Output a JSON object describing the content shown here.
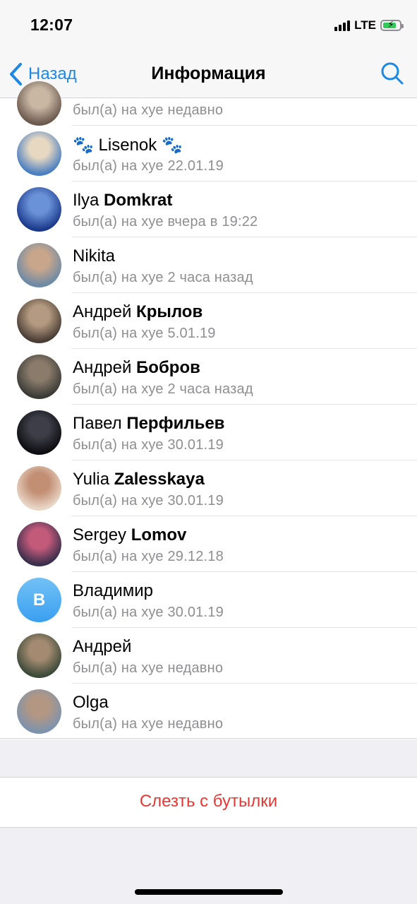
{
  "status_bar": {
    "time": "12:07",
    "network": "LTE"
  },
  "nav": {
    "back_label": "Назад",
    "title": "Информация"
  },
  "members": [
    {
      "name": "",
      "last": "",
      "status": "был(а) на хуе недавно",
      "partial": true,
      "avatar": [
        "#6b5a4e",
        "#c9b7a4"
      ]
    },
    {
      "name": "🐾 Lisenok 🐾",
      "last": "",
      "status": "был(а) на хуе 22.01.19",
      "avatar": [
        "#4a7fc1",
        "#e7d8c2"
      ]
    },
    {
      "name": "Ilya",
      "last": "Domkrat",
      "status": "был(а) на хуе вчера в 19:22",
      "avatar": [
        "#1c3a8c",
        "#6a92d8"
      ]
    },
    {
      "name": "Nikita",
      "last": "",
      "status": "был(а) на хуе 2 часа назад",
      "avatar": [
        "#6e8aa5",
        "#c7a68c"
      ]
    },
    {
      "name": "Андрей",
      "last": "Крылов",
      "status": "был(а) на хуе 5.01.19",
      "avatar": [
        "#4a3e36",
        "#b49a80"
      ]
    },
    {
      "name": "Андрей",
      "last": "Бобров",
      "status": "был(а) на хуе 2 часа назад",
      "avatar": [
        "#3b3b36",
        "#8a7b6b"
      ]
    },
    {
      "name": "Павел",
      "last": "Перфильев",
      "status": "был(а) на хуе 30.01.19",
      "avatar": [
        "#0d0d12",
        "#3e3e48"
      ]
    },
    {
      "name": "Yulia",
      "last": "Zalesskaya",
      "status": "был(а) на хуе 30.01.19",
      "avatar": [
        "#e9d6c6",
        "#c28e74"
      ]
    },
    {
      "name": "Sergey",
      "last": "Lomov",
      "status": "был(а) на хуе 29.12.18",
      "avatar": [
        "#3a2f4c",
        "#c35a7a"
      ]
    },
    {
      "name": "Владимир",
      "last": "",
      "status": "был(а) на хуе 30.01.19",
      "letter": "В"
    },
    {
      "name": "Андрей",
      "last": "",
      "status": "был(а) на хуе недавно",
      "avatar": [
        "#3c4a3a",
        "#a38a70"
      ]
    },
    {
      "name": "Olga",
      "last": "",
      "status": "был(а) на хуе недавно",
      "avatar": [
        "#7d93ad",
        "#b39783"
      ]
    }
  ],
  "actions": {
    "leave_label": "Слезть с бутылки"
  },
  "colors": {
    "accent": "#1e88e5",
    "destructive": "#e53935",
    "secondary_text": "#8e8e93"
  }
}
